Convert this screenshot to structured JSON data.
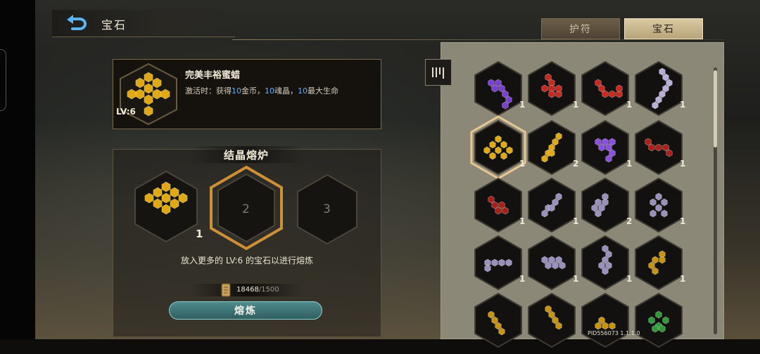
{
  "header": {
    "title": "宝石"
  },
  "tabs": [
    {
      "label": "护符",
      "active": false
    },
    {
      "label": "宝石",
      "active": true
    }
  ],
  "selected_gem": {
    "name": "完美丰裕蜜蜡",
    "level": "LV:6",
    "desc_prefix": "激活时：获得",
    "desc_parts": [
      "10",
      "金币，",
      "10",
      "魂晶，",
      "10",
      "最大生命"
    ]
  },
  "furnace": {
    "title": "结晶熔炉",
    "slot1_count": "1",
    "slot2_label": "2",
    "slot3_label": "3",
    "hint": "放入更多的 LV:6 的宝石以进行熔炼",
    "cost_current": "18468",
    "cost_max": "/1500",
    "smelt_label": "熔炼"
  },
  "inventory": {
    "gems": [
      {
        "color": "#7a3fd0",
        "count": "1"
      },
      {
        "color": "#c8281e",
        "count": "1"
      },
      {
        "color": "#c8281e",
        "count": "1"
      },
      {
        "color": "#b8aed8",
        "count": "1"
      },
      {
        "color": "#e0a812",
        "count": "1",
        "selected": true
      },
      {
        "color": "#e0a812",
        "count": "2"
      },
      {
        "color": "#8b4fe0",
        "count": "1"
      },
      {
        "color": "#a82018",
        "count": "1"
      },
      {
        "color": "#a82018",
        "count": "1"
      },
      {
        "color": "#9a90bc",
        "count": "1"
      },
      {
        "color": "#9a90bc",
        "count": "2"
      },
      {
        "color": "#9a90bc",
        "count": "1"
      },
      {
        "color": "#9a90bc",
        "count": "1"
      },
      {
        "color": "#9a90bc",
        "count": "1"
      },
      {
        "color": "#9a90bc",
        "count": "1"
      },
      {
        "color": "#c89410",
        "count": "1"
      },
      {
        "color": "#c89410",
        "count": ""
      },
      {
        "color": "#c89410",
        "count": ""
      },
      {
        "color": "#c89410",
        "count": ""
      },
      {
        "color": "#2e9a38",
        "count": ""
      }
    ]
  },
  "footer": {
    "pid": "PID556073  1.1.1.0"
  }
}
